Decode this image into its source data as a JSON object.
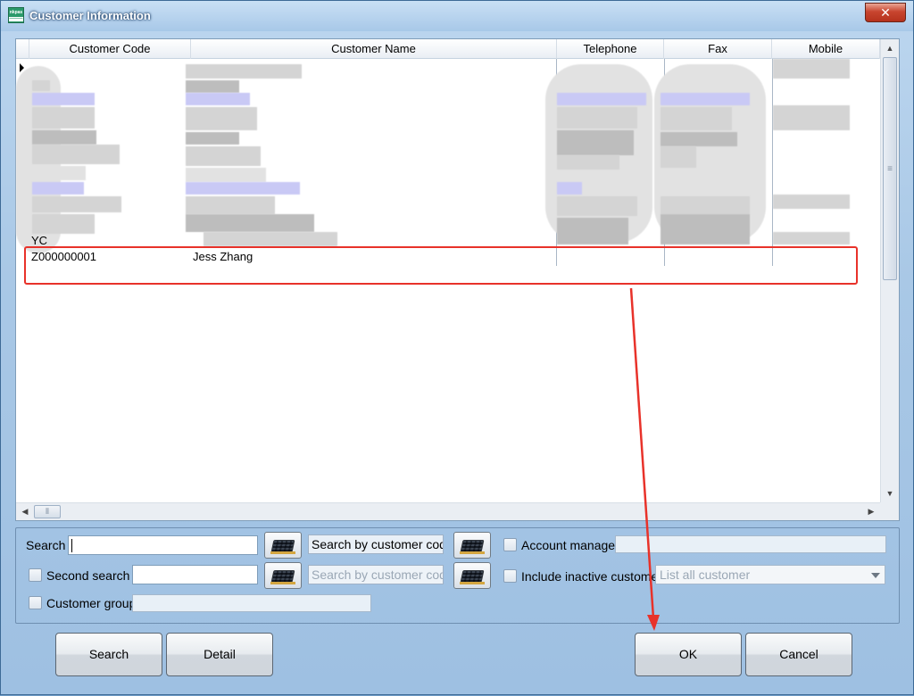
{
  "window": {
    "title": "Customer Information",
    "close_glyph": "✕"
  },
  "grid": {
    "columns": [
      "Customer Code",
      "Customer Name",
      "Telephone",
      "Fax",
      "Mobile"
    ],
    "partial_row_code": "YC",
    "highlighted_row": {
      "customer_code": "Z000000001",
      "customer_name": "Jess Zhang"
    }
  },
  "filters": {
    "search_label": "Search",
    "search_value": "",
    "search_mode": "Search by customer code",
    "account_manager_label": "Account manager",
    "account_manager_value": "",
    "second_search_label": "Second search",
    "second_search_value": "",
    "second_search_mode": "Search by customer code",
    "include_inactive_label": "Include inactive customer",
    "list_option": "List all customer",
    "customer_group_label": "Customer group",
    "customer_group_value": ""
  },
  "buttons": {
    "search": "Search",
    "detail": "Detail",
    "ok": "OK",
    "cancel": "Cancel"
  },
  "annotation_color": "#e8322a"
}
